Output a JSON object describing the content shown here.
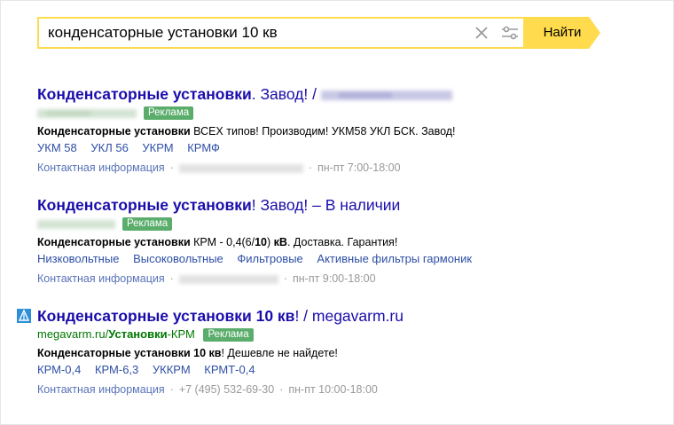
{
  "search": {
    "query": "конденсаторные установки 10 кв",
    "button_label": "Найти"
  },
  "results": [
    {
      "title_bold": "Конденсаторные установки",
      "title_rest": ". Завод! /",
      "badge": "Реклама",
      "desc_bold": "Конденсаторные установки",
      "desc_rest": " ВСЕХ типов! Производим! УКМ58 УКЛ БСК. Завод!",
      "links": [
        "УКМ 58",
        "УКЛ 56",
        "УКРМ",
        "КРМФ"
      ],
      "contact_label": "Контактная информация",
      "hours": "пн-пт 7:00-18:00"
    },
    {
      "title_bold": "Конденсаторные установки",
      "title_rest": "! Завод! – В наличии",
      "badge": "Реклама",
      "desc_bold": "Конденсаторные установки",
      "desc_mid": " КРМ - 0,4(6/",
      "desc_bold2": "10",
      "desc_mid2": ") ",
      "desc_bold3": "кВ",
      "desc_rest": ". Доставка. Гарантия!",
      "links": [
        "Низковольтные",
        "Высоковольтные",
        "Фильтровые",
        "Активные фильтры гармоник"
      ],
      "contact_label": "Контактная информация",
      "hours": "пн-пт 9:00-18:00"
    },
    {
      "title_bold": "Конденсаторные установки 10 кв",
      "title_rest": "! / megavarm.ru",
      "url_pre": "megavarm.ru/",
      "url_bold": "Установки",
      "url_post": "-КРМ",
      "badge": "Реклама",
      "desc_bold": "Конденсаторные установки 10 кв",
      "desc_rest": "! Дешевле не найдете!",
      "links": [
        "КРМ-0,4",
        "КРМ-6,3",
        "УККРМ",
        "КРМТ-0,4"
      ],
      "contact_label": "Контактная информация",
      "phone": "+7 (495) 532-69-30",
      "hours": "пн-пт 10:00-18:00"
    }
  ],
  "colors": {
    "accent_yellow": "#ffdb4d",
    "title_link": "#1a0dab",
    "ad_badge": "#5aad6b",
    "green_url": "#007700",
    "sitelink": "#2e4fa6"
  },
  "icons": [
    "clear-icon",
    "filter-settings-icon",
    "site-favicon"
  ]
}
